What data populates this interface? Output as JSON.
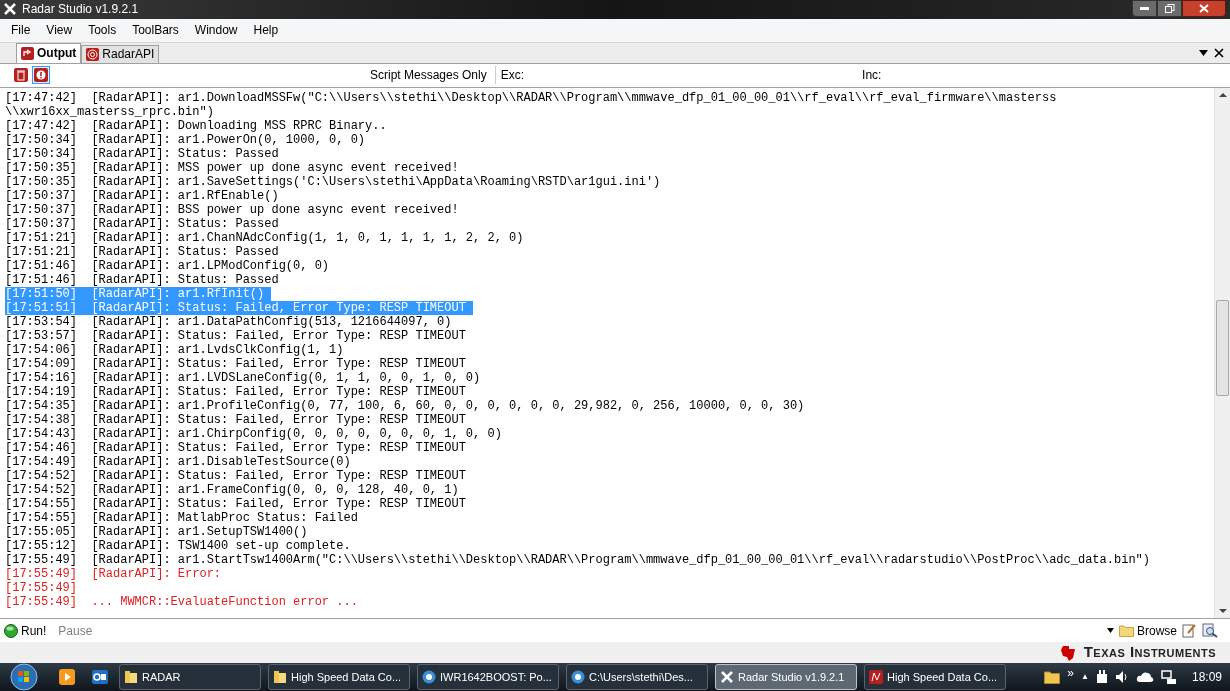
{
  "window": {
    "title": "Radar Studio v1.9.2.1"
  },
  "menu": [
    "File",
    "View",
    "Tools",
    "ToolBars",
    "Window",
    "Help"
  ],
  "tabs": [
    {
      "label": "Output",
      "selected": true
    },
    {
      "label": "RadarAPI",
      "selected": false
    }
  ],
  "toolbar": {
    "filter_label": "Script Messages Only",
    "exc_label": "Exc:",
    "inc_label": "Inc:"
  },
  "log": [
    {
      "kind": "info",
      "time": "[17:47:42]",
      "text": "[RadarAPI]: ar1.DownloadMSSFw(\"C:\\\\Users\\\\stethi\\\\Desktop\\\\RADAR\\\\Program\\\\mmwave_dfp_01_00_00_01\\\\rf_eval\\\\rf_eval_firmware\\\\masterss",
      "selected": false
    },
    {
      "kind": "wrap",
      "text": "\\\\xwr16xx_masterss_rprc.bin\")",
      "selected": false
    },
    {
      "kind": "info",
      "time": "[17:47:42]",
      "text": "[RadarAPI]: Downloading MSS RPRC Binary..",
      "selected": false
    },
    {
      "kind": "info",
      "time": "[17:50:34]",
      "text": "[RadarAPI]: ar1.PowerOn(0, 1000, 0, 0)",
      "selected": false
    },
    {
      "kind": "info",
      "time": "[17:50:34]",
      "text": "[RadarAPI]: Status: Passed",
      "selected": false
    },
    {
      "kind": "info",
      "time": "[17:50:35]",
      "text": "[RadarAPI]: MSS power up done async event received!",
      "selected": false
    },
    {
      "kind": "info",
      "time": "[17:50:35]",
      "text": "[RadarAPI]: ar1.SaveSettings('C:\\Users\\stethi\\AppData\\Roaming\\RSTD\\ar1gui.ini')",
      "selected": false
    },
    {
      "kind": "info",
      "time": "[17:50:37]",
      "text": "[RadarAPI]: ar1.RfEnable()",
      "selected": false
    },
    {
      "kind": "info",
      "time": "[17:50:37]",
      "text": "[RadarAPI]: BSS power up done async event received!",
      "selected": false
    },
    {
      "kind": "info",
      "time": "[17:50:37]",
      "text": "[RadarAPI]: Status: Passed",
      "selected": false
    },
    {
      "kind": "info",
      "time": "[17:51:21]",
      "text": "[RadarAPI]: ar1.ChanNAdcConfig(1, 1, 0, 1, 1, 1, 1, 2, 2, 0)",
      "selected": false
    },
    {
      "kind": "info",
      "time": "[17:51:21]",
      "text": "[RadarAPI]: Status: Passed",
      "selected": false
    },
    {
      "kind": "info",
      "time": "[17:51:46]",
      "text": "[RadarAPI]: ar1.LPModConfig(0, 0)",
      "selected": false
    },
    {
      "kind": "info",
      "time": "[17:51:46]",
      "text": "[RadarAPI]: Status: Passed",
      "selected": false
    },
    {
      "kind": "info",
      "time": "[17:51:50]",
      "text": "[RadarAPI]: ar1.RfInit()",
      "selected": true
    },
    {
      "kind": "info",
      "time": "[17:51:51]",
      "text": "[RadarAPI]: Status: Failed, Error Type: RESP TIMEOUT",
      "selected": true
    },
    {
      "kind": "info",
      "time": "[17:53:54]",
      "text": "[RadarAPI]: ar1.DataPathConfig(513, 1216644097, 0)",
      "selected": false
    },
    {
      "kind": "info",
      "time": "[17:53:57]",
      "text": "[RadarAPI]: Status: Failed, Error Type: RESP TIMEOUT",
      "selected": false
    },
    {
      "kind": "info",
      "time": "[17:54:06]",
      "text": "[RadarAPI]: ar1.LvdsClkConfig(1, 1)",
      "selected": false
    },
    {
      "kind": "info",
      "time": "[17:54:09]",
      "text": "[RadarAPI]: Status: Failed, Error Type: RESP TIMEOUT",
      "selected": false
    },
    {
      "kind": "info",
      "time": "[17:54:16]",
      "text": "[RadarAPI]: ar1.LVDSLaneConfig(0, 1, 1, 0, 0, 1, 0, 0)",
      "selected": false
    },
    {
      "kind": "info",
      "time": "[17:54:19]",
      "text": "[RadarAPI]: Status: Failed, Error Type: RESP TIMEOUT",
      "selected": false
    },
    {
      "kind": "info",
      "time": "[17:54:35]",
      "text": "[RadarAPI]: ar1.ProfileConfig(0, 77, 100, 6, 60, 0, 0, 0, 0, 0, 0, 29,982, 0, 256, 10000, 0, 0, 30)",
      "selected": false
    },
    {
      "kind": "info",
      "time": "[17:54:38]",
      "text": "[RadarAPI]: Status: Failed, Error Type: RESP TIMEOUT",
      "selected": false
    },
    {
      "kind": "info",
      "time": "[17:54:43]",
      "text": "[RadarAPI]: ar1.ChirpConfig(0, 0, 0, 0, 0, 0, 0, 1, 0, 0)",
      "selected": false
    },
    {
      "kind": "info",
      "time": "[17:54:46]",
      "text": "[RadarAPI]: Status: Failed, Error Type: RESP TIMEOUT",
      "selected": false
    },
    {
      "kind": "info",
      "time": "[17:54:49]",
      "text": "[RadarAPI]: ar1.DisableTestSource(0)",
      "selected": false
    },
    {
      "kind": "info",
      "time": "[17:54:52]",
      "text": "[RadarAPI]: Status: Failed, Error Type: RESP TIMEOUT",
      "selected": false
    },
    {
      "kind": "info",
      "time": "[17:54:52]",
      "text": "[RadarAPI]: ar1.FrameConfig(0, 0, 0, 128, 40, 0, 1)",
      "selected": false
    },
    {
      "kind": "info",
      "time": "[17:54:55]",
      "text": "[RadarAPI]: Status: Failed, Error Type: RESP TIMEOUT",
      "selected": false
    },
    {
      "kind": "info",
      "time": "[17:54:55]",
      "text": "[RadarAPI]: MatlabProc Status: Failed",
      "selected": false
    },
    {
      "kind": "info",
      "time": "[17:55:05]",
      "text": "[RadarAPI]: ar1.SetupTSW1400()",
      "selected": false
    },
    {
      "kind": "info",
      "time": "[17:55:12]",
      "text": "[RadarAPI]: TSW1400 set-up complete.",
      "selected": false
    },
    {
      "kind": "info",
      "time": "[17:55:49]",
      "text": "[RadarAPI]: ar1.StartTsw1400Arm(\"C:\\\\Users\\\\stethi\\\\Desktop\\\\RADAR\\\\Program\\\\mmwave_dfp_01_00_00_01\\\\rf_eval\\\\radarstudio\\\\PostProc\\\\adc_data.bin\")",
      "selected": false
    },
    {
      "kind": "error",
      "time": "[17:55:49]",
      "text": "[RadarAPI]: Error:",
      "selected": false
    },
    {
      "kind": "error",
      "time": "[17:55:49]",
      "selected": false
    },
    {
      "kind": "error",
      "time": "[17:55:49]",
      "text": "... MWMCR::EvaluateFunction error ...",
      "selected": false
    }
  ],
  "bottom_toolbar": {
    "run": "Run!",
    "pause": "Pause",
    "browse": "Browse"
  },
  "brand": "Texas Instruments",
  "taskbar": {
    "items": [
      {
        "label": "RADAR",
        "selected": false
      },
      {
        "label": "High Speed Data Co...",
        "selected": false
      },
      {
        "label": "IWR1642BOOST: Po...",
        "selected": false
      },
      {
        "label": "C:\\Users\\stethi\\Des...",
        "selected": false
      },
      {
        "label": "Radar Studio v1.9.2.1",
        "selected": true
      },
      {
        "label": "High Speed Data Co...",
        "selected": false
      }
    ],
    "overflow": "»",
    "tray_arrow": "▲",
    "clock": "18:09"
  }
}
